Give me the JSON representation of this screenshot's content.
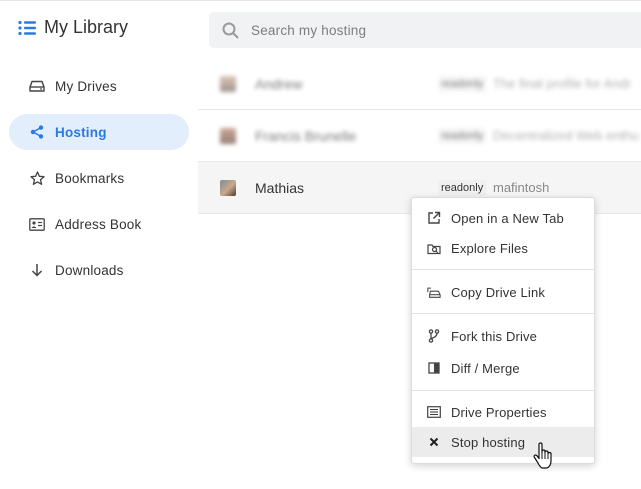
{
  "header": {
    "title": "My Library",
    "search_placeholder": "Search my hosting"
  },
  "sidebar": {
    "items": [
      {
        "label": "My Drives",
        "icon": "drive-icon"
      },
      {
        "label": "Hosting",
        "icon": "share-icon",
        "active": true
      },
      {
        "label": "Bookmarks",
        "icon": "star-icon"
      },
      {
        "label": "Address Book",
        "icon": "contact-card-icon"
      },
      {
        "label": "Downloads",
        "icon": "arrow-down-icon"
      }
    ]
  },
  "drives": [
    {
      "name": "Andrew",
      "badge": "readonly",
      "description": "The final profile for Andr"
    },
    {
      "name": "Francis Brunelle",
      "badge": "readonly",
      "description": "Decentralized Web enthu"
    },
    {
      "name": "Mathias",
      "badge": "readonly",
      "description": "mafintosh"
    }
  ],
  "context_menu": {
    "items": [
      {
        "label": "Open in a New Tab",
        "icon": "external-link-icon"
      },
      {
        "label": "Explore Files",
        "icon": "folder-search-icon"
      },
      {
        "label": "Copy Drive Link",
        "icon": "copy-link-icon"
      },
      {
        "label": "Fork this Drive",
        "icon": "fork-icon"
      },
      {
        "label": "Diff / Merge",
        "icon": "diff-icon"
      },
      {
        "label": "Drive Properties",
        "icon": "list-icon"
      },
      {
        "label": "Stop hosting",
        "icon": "x-icon"
      }
    ]
  },
  "colors": {
    "accent": "#2979e6",
    "active_bg": "#e3eefc"
  }
}
